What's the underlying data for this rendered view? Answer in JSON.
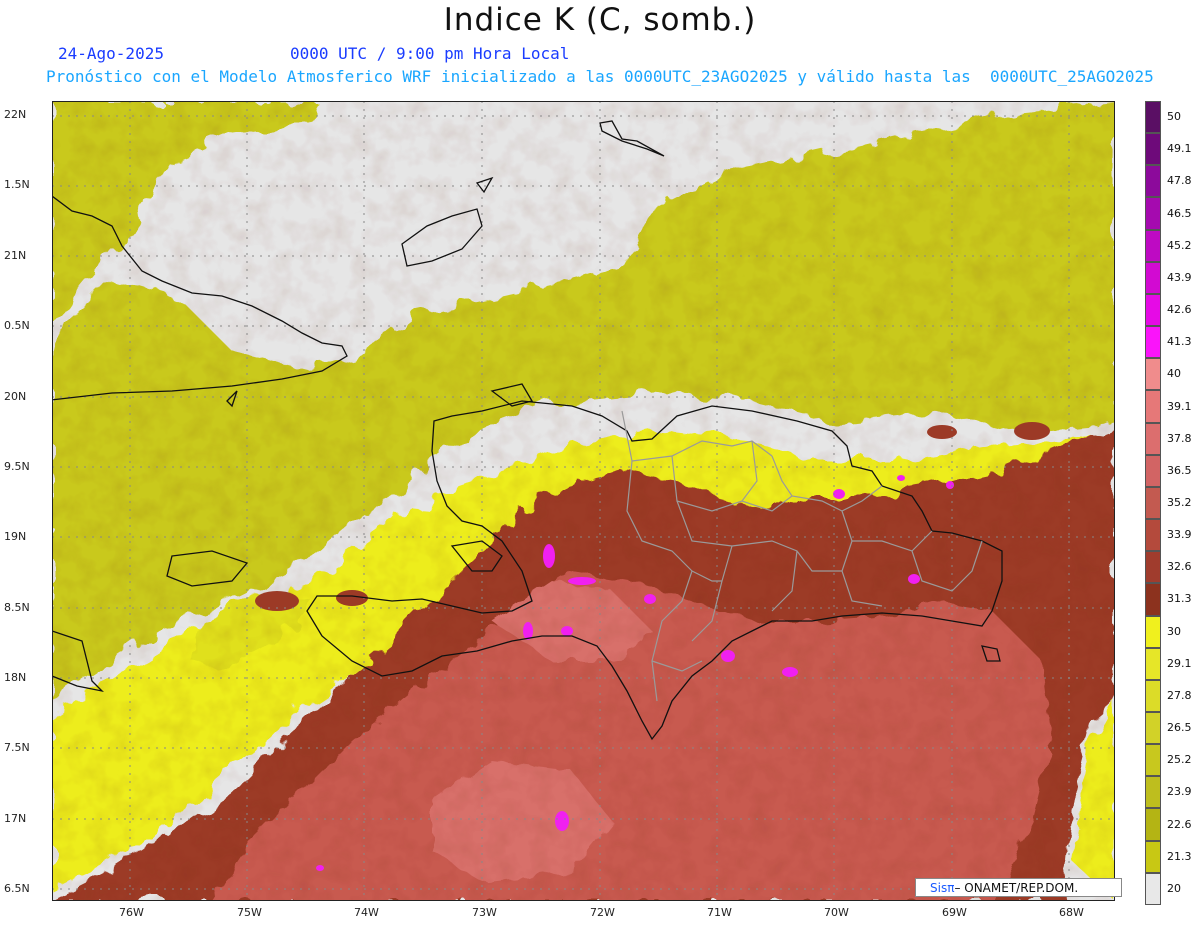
{
  "header": {
    "title": "Indice K (C, somb.)",
    "date": "24-Ago-2025",
    "time": "0000 UTC / 9:00 pm Hora Local",
    "description": "Pronóstico con el Modelo Atmosferico WRF inicializado a las 0000UTC_23AGO2025 y válido hasta las  0000UTC_25AGO2025"
  },
  "axes": {
    "lat_labels": [
      "22N",
      "1.5N",
      "21N",
      "0.5N",
      "20N",
      "9.5N",
      "19N",
      "8.5N",
      "18N",
      "7.5N",
      "17N",
      "6.5N"
    ],
    "lon_labels": [
      "76W",
      "75W",
      "74W",
      "73W",
      "72W",
      "71W",
      "70W",
      "69W",
      "68W"
    ]
  },
  "colorbar": {
    "labels": [
      "50",
      "49.1",
      "47.8",
      "46.5",
      "45.2",
      "43.9",
      "42.6",
      "41.3",
      "40",
      "39.1",
      "37.8",
      "36.5",
      "35.2",
      "33.9",
      "32.6",
      "31.3",
      "30",
      "29.1",
      "27.8",
      "26.5",
      "25.2",
      "23.9",
      "22.6",
      "21.3",
      "20"
    ],
    "colors": [
      "#5a0f64",
      "#6e0a7a",
      "#8c0a9b",
      "#a50aaf",
      "#be0ac3",
      "#d20ad2",
      "#e60ae6",
      "#fa14fa",
      "#f08c8c",
      "#e67878",
      "#dc6e6e",
      "#d26464",
      "#c35a50",
      "#b44a3c",
      "#a03c2d",
      "#8c321e",
      "#f0f01e",
      "#e6e628",
      "#dcdc28",
      "#d2d228",
      "#c8c81e",
      "#bebe1e",
      "#b4b414",
      "#c8c814",
      "#e8e8e8"
    ]
  },
  "credit": {
    "sis": "Sisπ",
    "rest": " – ONAMET/REP.DOM."
  },
  "map": {
    "ocean_color": "#e6e6e6",
    "low_k_color": "#c9c91c",
    "mid_k_color": "#f2f21a",
    "high_k_color": "#c0524a",
    "very_high_color": "#8b2e1c",
    "extreme_color": "#f0f"
  }
}
